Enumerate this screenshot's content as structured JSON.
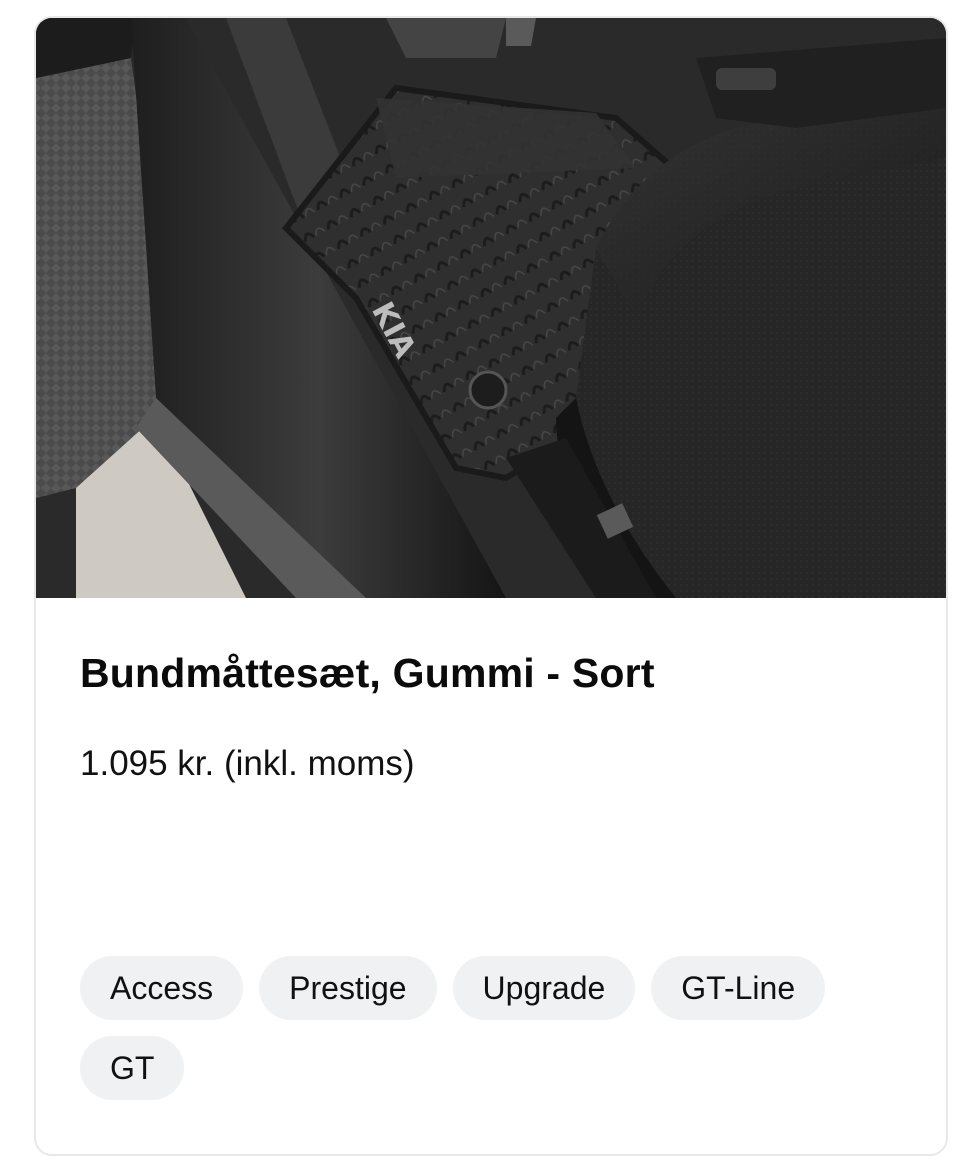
{
  "product": {
    "image_alt": "Bundmåttesæt, Gummi - Sort",
    "logo_text": "KIA",
    "title": "Bundmåttesæt, Gummi - Sort",
    "price": "1.095 kr. (inkl. moms)"
  },
  "trims": [
    "Access",
    "Prestige",
    "Upgrade",
    "GT-Line",
    "GT"
  ],
  "colors": {
    "card_border": "#e6e8eb",
    "chip_background": "#f0f1f2",
    "text": "#111111"
  }
}
